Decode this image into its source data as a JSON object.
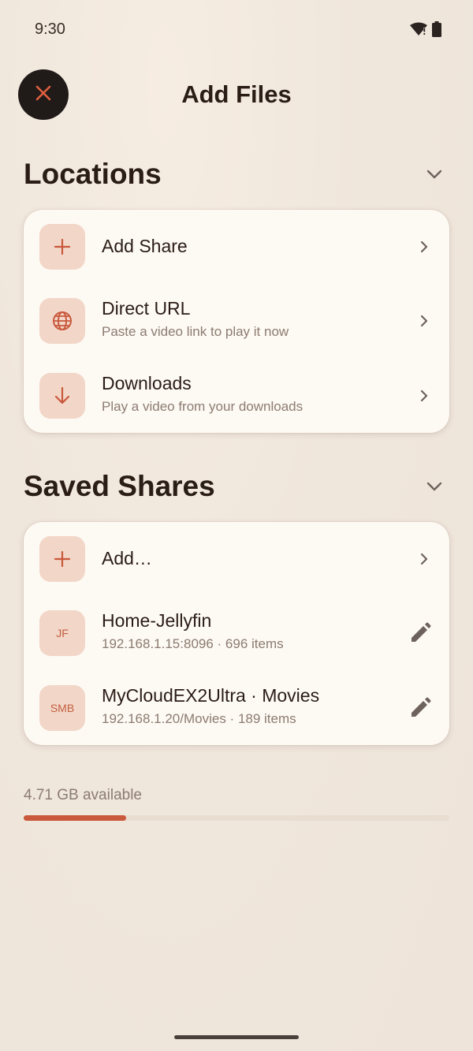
{
  "status_bar": {
    "time": "9:30"
  },
  "header": {
    "title": "Add Files",
    "close_icon": "close-icon"
  },
  "locations": {
    "title": "Locations",
    "items": [
      {
        "title": "Add Share",
        "subtitle": "",
        "icon": "plus-icon"
      },
      {
        "title": "Direct URL",
        "subtitle": "Paste a video link to play it now",
        "icon": "globe-icon"
      },
      {
        "title": "Downloads",
        "subtitle": "Play a video from your downloads",
        "icon": "download-icon"
      }
    ]
  },
  "saved_shares": {
    "title": "Saved Shares",
    "add_label": "Add…",
    "items": [
      {
        "badge": "JF",
        "title": "Home-Jellyfin",
        "subtitle": "192.168.1.15:8096 · 696 items"
      },
      {
        "badge": "SMB",
        "title": "MyCloudEX2Ultra · Movies",
        "subtitle": "192.168.1.20/Movies · 189 items"
      }
    ]
  },
  "storage": {
    "label": "4.71 GB available",
    "used_fraction": 0.24
  },
  "colors": {
    "accent": "#c9583c",
    "icon_bg": "#f2d6c8",
    "card_bg": "#fdf9f3",
    "background": "#efe6dc"
  }
}
